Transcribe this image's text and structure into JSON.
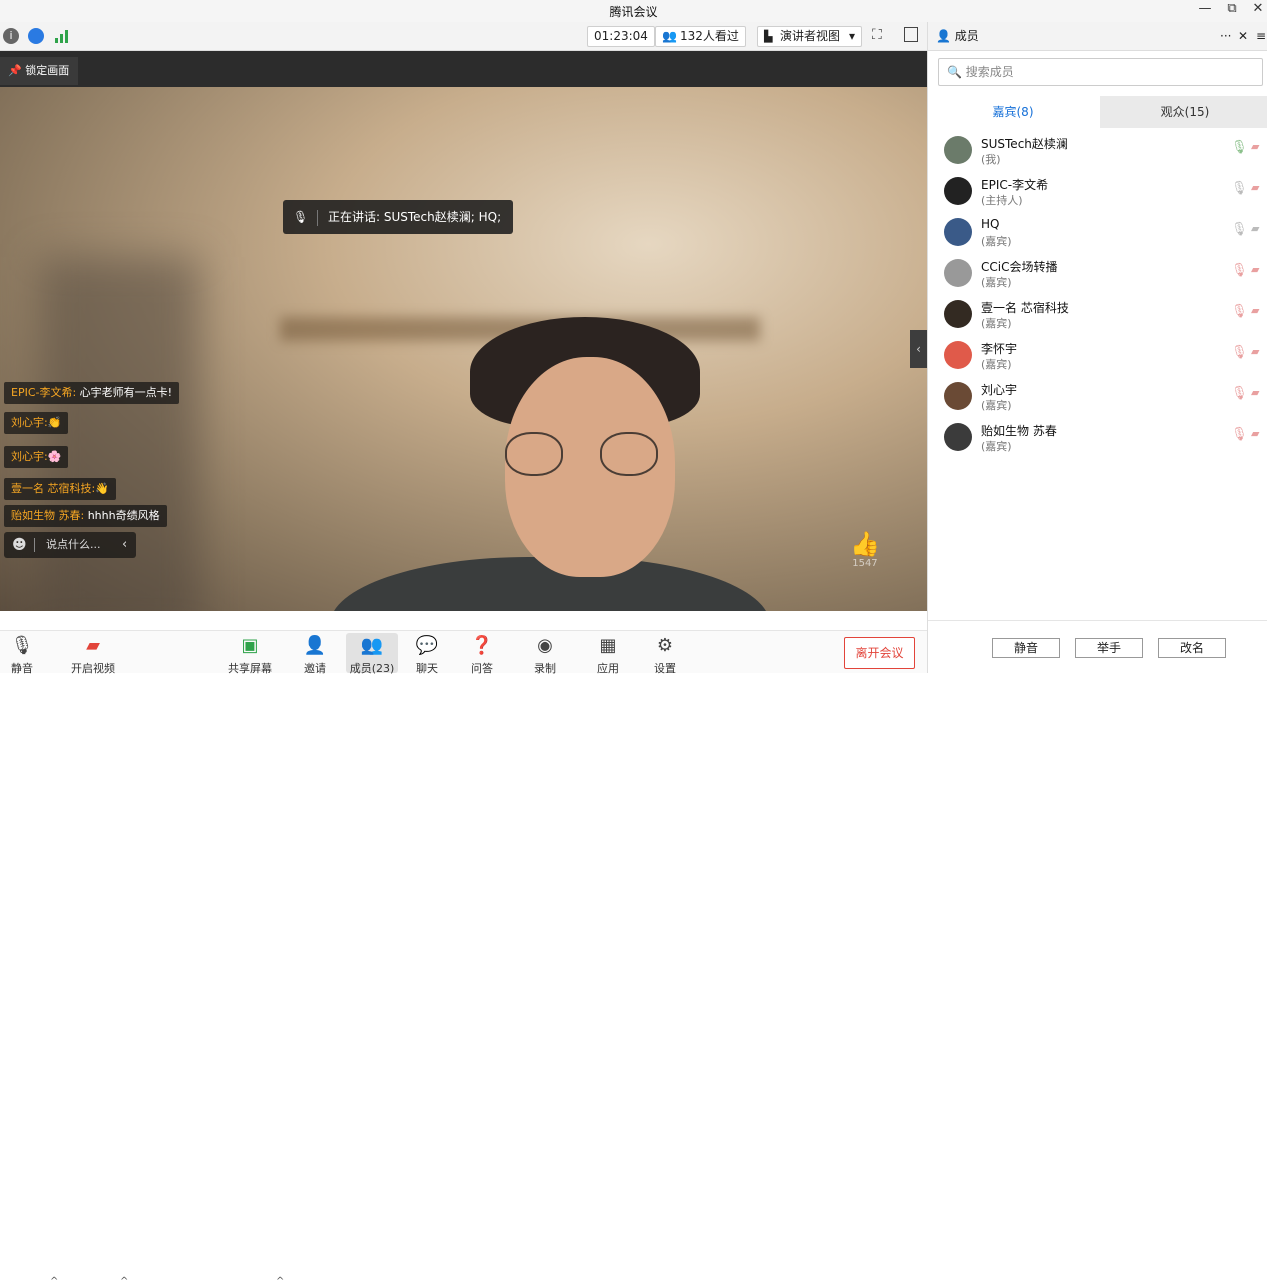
{
  "window": {
    "title": "腾讯会议",
    "minimize": "—",
    "restore": "⧉",
    "close": "✕"
  },
  "toolbar": {
    "timer": "01:23:04",
    "viewers": "132人看过",
    "view_mode": "演讲者视图",
    "view_caret": "▾"
  },
  "video": {
    "lock_label": "锁定画面",
    "speaking_text": "正在讲话: SUSTech赵椟澜; HQ;",
    "like_count": "1547",
    "chat": [
      {
        "name": "EPIC-李文希:",
        "text": " 心宇老师有一点卡!",
        "emoji": ""
      },
      {
        "name": "刘心宇:",
        "text": "",
        "emoji": "👏"
      },
      {
        "name": "刘心宇:",
        "text": "",
        "emoji": "🌸"
      },
      {
        "name": "壹一名 芯宿科技:",
        "text": "",
        "emoji": "👋"
      },
      {
        "name": "贻如生物 苏春:",
        "text": " hhhh奇绩风格",
        "emoji": ""
      }
    ],
    "chat_placeholder": "说点什么..."
  },
  "bottom": {
    "mute": "静音",
    "video": "开启视频",
    "share": "共享屏幕",
    "invite": "邀请",
    "members": "成员(23)",
    "chat": "聊天",
    "qa": "问答",
    "record": "录制",
    "apps": "应用",
    "settings": "设置",
    "leave": "离开会议"
  },
  "panel": {
    "title": "成员",
    "more": "···",
    "close": "✕",
    "search_placeholder": "搜索成员",
    "tab_guests": "嘉宾(8)",
    "tab_audience": "观众(15)",
    "members": [
      {
        "name": "SUSTech赵椟澜",
        "role": "(我)",
        "mic": "on"
      },
      {
        "name": "EPIC-李文希",
        "role": "(主持人)",
        "mic": "on"
      },
      {
        "name": "HQ",
        "role": "(嘉宾)",
        "mic": "on"
      },
      {
        "name": "CCiC会场转播",
        "role": "(嘉宾)",
        "mic": "off"
      },
      {
        "name": "壹一名 芯宿科技",
        "role": "(嘉宾)",
        "mic": "off"
      },
      {
        "name": "李怀宇",
        "role": "(嘉宾)",
        "mic": "off"
      },
      {
        "name": "刘心宇",
        "role": "(嘉宾)",
        "mic": "off"
      },
      {
        "name": "贻如生物 苏春",
        "role": "(嘉宾)",
        "mic": "off"
      }
    ],
    "btn_mute": "静音",
    "btn_raise": "举手",
    "btn_rename": "改名"
  },
  "colors": {
    "accent": "#1670d8",
    "leave": "#e2443a",
    "chat_name": "#f6a623"
  }
}
